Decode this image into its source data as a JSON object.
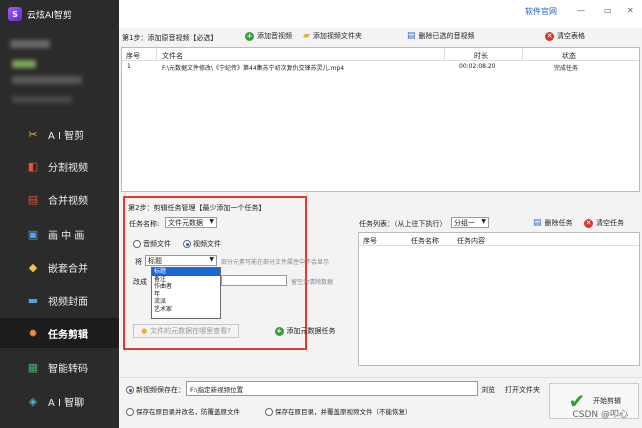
{
  "app": {
    "title": "云炫AI智剪"
  },
  "topbar": {
    "help_link": "软件官网"
  },
  "sidebar": {
    "items": [
      {
        "label": "A I 智剪",
        "icon": "ai-cut-icon"
      },
      {
        "label": "分割视频",
        "icon": "split-video-icon"
      },
      {
        "label": "合并视频",
        "icon": "merge-video-icon"
      },
      {
        "label": "画 中 画",
        "icon": "picture-in-picture-icon"
      },
      {
        "label": "嵌套合并",
        "icon": "nested-merge-icon"
      },
      {
        "label": "视频封面",
        "icon": "video-cover-icon"
      },
      {
        "label": "任务剪辑",
        "icon": "task-edit-icon"
      },
      {
        "label": "智能转码",
        "icon": "transcode-icon"
      },
      {
        "label": "A I 智聊",
        "icon": "ai-chat-icon"
      }
    ]
  },
  "step1": {
    "label": "第1步：添加原音视频【必选】",
    "add_av": "添加音视频",
    "add_folder": "添加视频文件夹",
    "delete_selected": "删除已选的音视频",
    "clear_table": "清空表格"
  },
  "table1": {
    "headers": {
      "index": "序号",
      "filename": "文件名",
      "duration": "时长",
      "status": "状态"
    },
    "rows": [
      {
        "index": "1",
        "filename": "F:\\元数据文件修改\\《宁纪传》第44集苏宁初次复仇交锋苏灵儿.mp4",
        "duration": "00:02:08.20",
        "status": "完成任务"
      }
    ]
  },
  "step2": {
    "label": "第2步：剪辑任务管理【最少添加一个任务】",
    "task_name_label": "任务名称:",
    "task_name_value": "文件元数据",
    "radio_audio": "音频文件",
    "radio_video": "视频文件",
    "field_label": "将",
    "field_value": "标题",
    "hint1": "部分元素可能在部分文件属性中不会显示",
    "change_label": "改成",
    "hint2": "留空为清除数据",
    "options": [
      "标题",
      "备注",
      "作曲者",
      "年",
      "流派",
      "艺术家"
    ],
    "where_btn": "文件的元数据在哪里查看?",
    "add_task_btn": "添加元数据任务"
  },
  "task_list": {
    "label": "任务列表：（从上往下执行）",
    "group_value": "分组一",
    "delete_task": "删除任务",
    "clear_task": "清空任务",
    "headers": {
      "index": "序号",
      "name": "任务名称",
      "content": "任务内容"
    }
  },
  "bottom": {
    "save_label": "新视频保存在：",
    "save_path": "F:\\指定新视频位置",
    "browse": "浏览",
    "open_folder": "打开文件夹",
    "option1": "保存在原目录并改名，防覆盖原文件",
    "option2": "保存在原目录，并覆盖原视频文件（不能恢复）",
    "start": "开始剪辑"
  },
  "watermark": "CSDN @叩心"
}
